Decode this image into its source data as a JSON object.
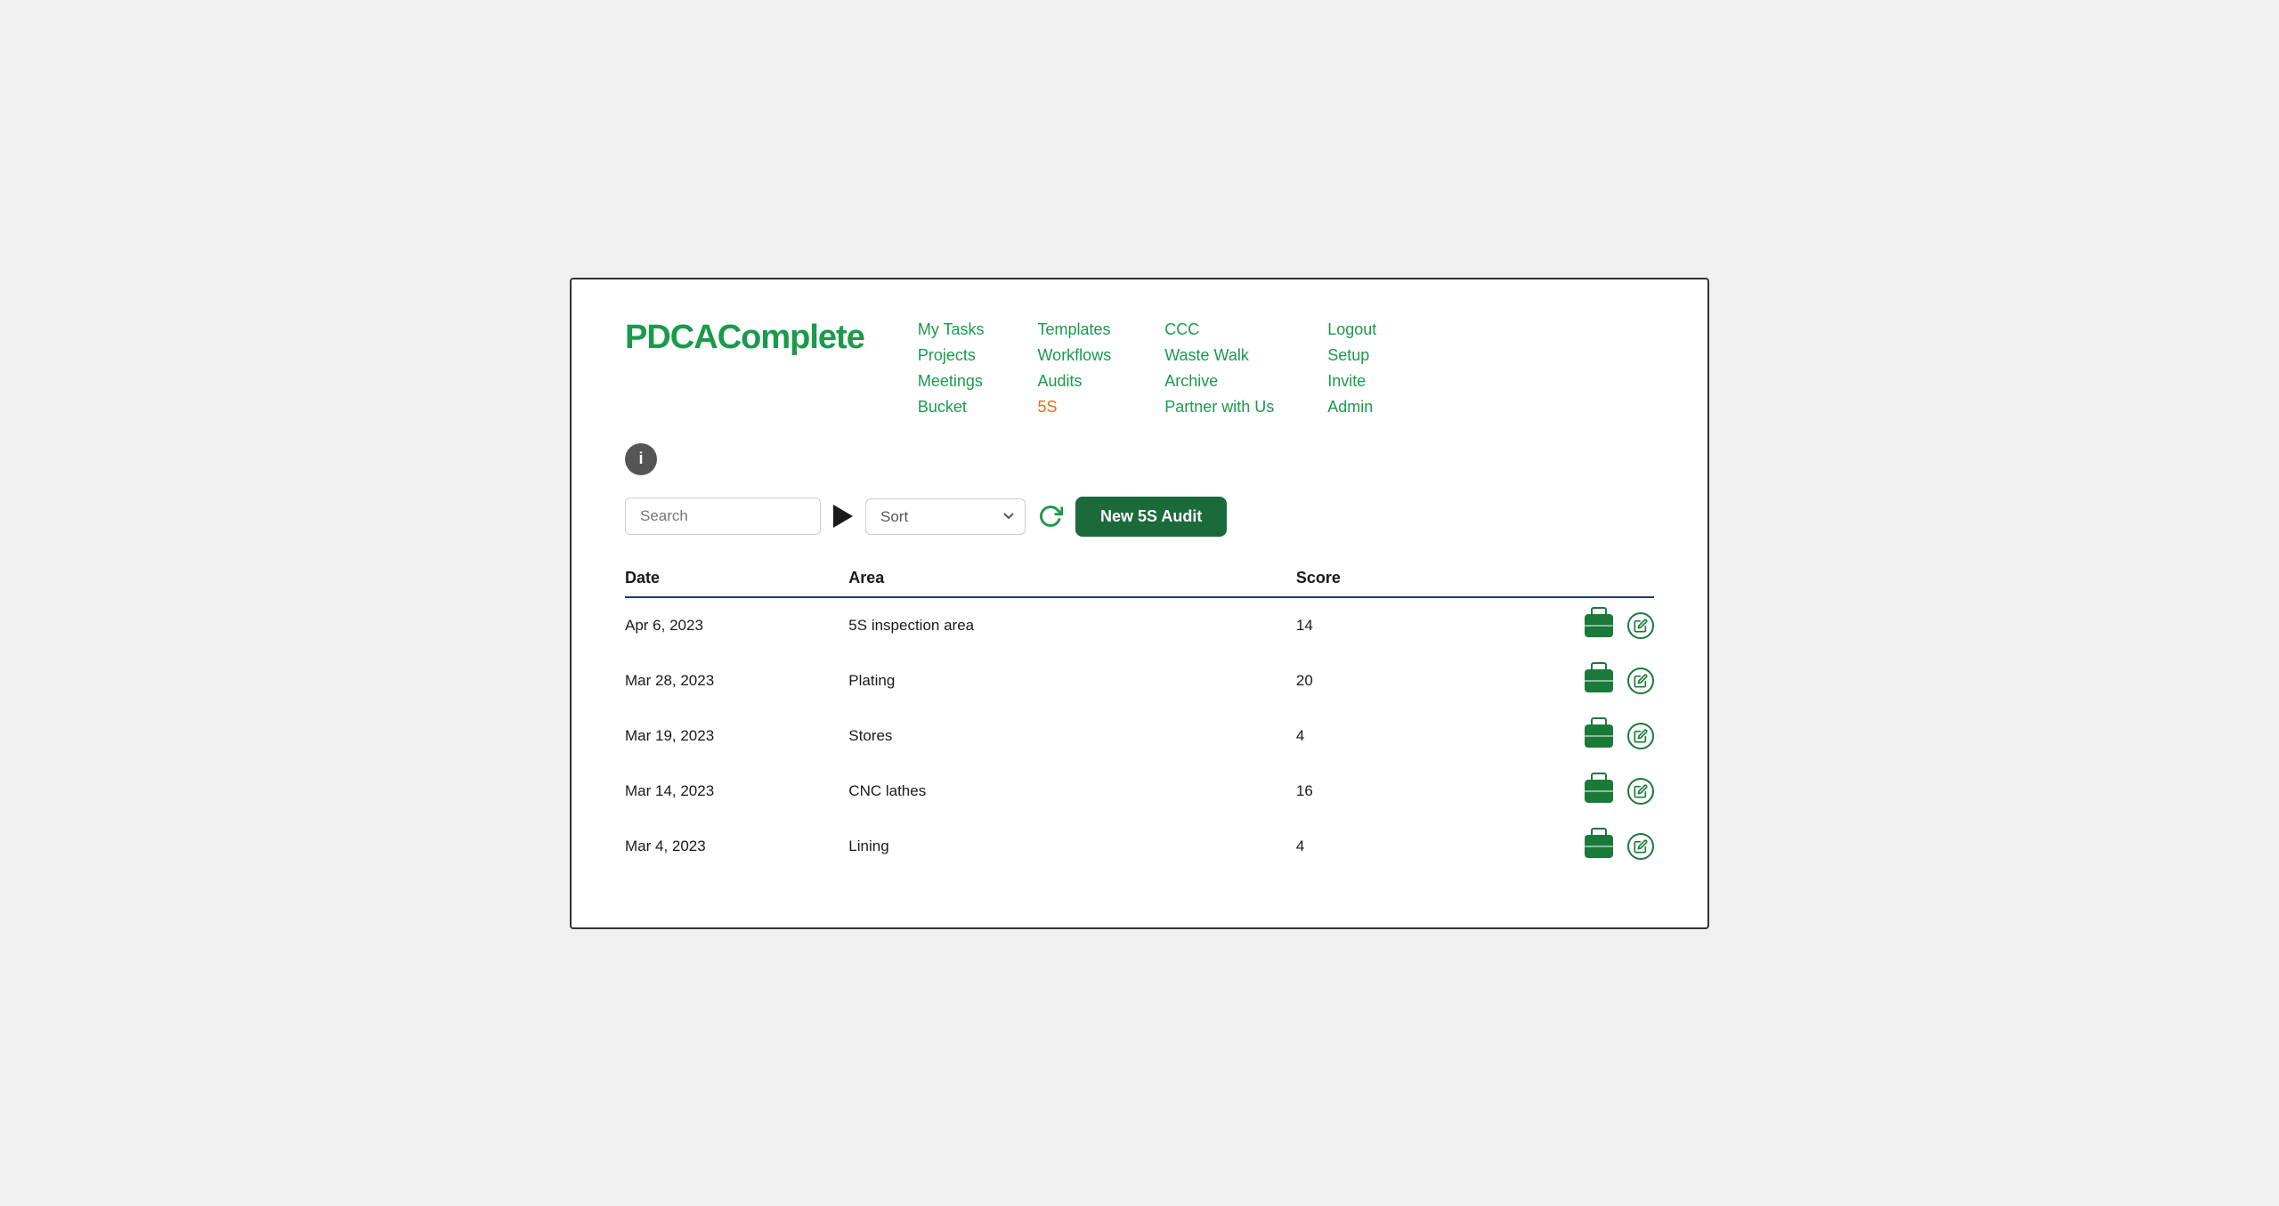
{
  "logo": {
    "prefix": "PDCA",
    "suffix": "Complete"
  },
  "nav": {
    "col1": [
      {
        "label": "My Tasks",
        "class": ""
      },
      {
        "label": "Projects",
        "class": ""
      },
      {
        "label": "Meetings",
        "class": ""
      },
      {
        "label": "Bucket",
        "class": ""
      }
    ],
    "col2": [
      {
        "label": "Templates",
        "class": ""
      },
      {
        "label": "Workflows",
        "class": ""
      },
      {
        "label": "Audits",
        "class": ""
      },
      {
        "label": "5S",
        "class": "orange"
      }
    ],
    "col3": [
      {
        "label": "CCC",
        "class": ""
      },
      {
        "label": "Waste Walk",
        "class": ""
      },
      {
        "label": "Archive",
        "class": ""
      },
      {
        "label": "Partner with Us",
        "class": ""
      }
    ],
    "col4": [
      {
        "label": "Logout",
        "class": ""
      },
      {
        "label": "Setup",
        "class": ""
      },
      {
        "label": "Invite",
        "class": ""
      },
      {
        "label": "Admin",
        "class": ""
      }
    ]
  },
  "toolbar": {
    "search_placeholder": "Search",
    "sort_label": "Sort",
    "new_audit_label": "New 5S Audit"
  },
  "table": {
    "headers": {
      "date": "Date",
      "area": "Area",
      "score": "Score"
    },
    "rows": [
      {
        "date": "Apr 6, 2023",
        "area": "5S inspection area",
        "score": "14"
      },
      {
        "date": "Mar 28, 2023",
        "area": "Plating",
        "score": "20"
      },
      {
        "date": "Mar 19, 2023",
        "area": "Stores",
        "score": "4"
      },
      {
        "date": "Mar 14, 2023",
        "area": "CNC lathes",
        "score": "16"
      },
      {
        "date": "Mar 4, 2023",
        "area": "Lining",
        "score": "4"
      }
    ]
  }
}
